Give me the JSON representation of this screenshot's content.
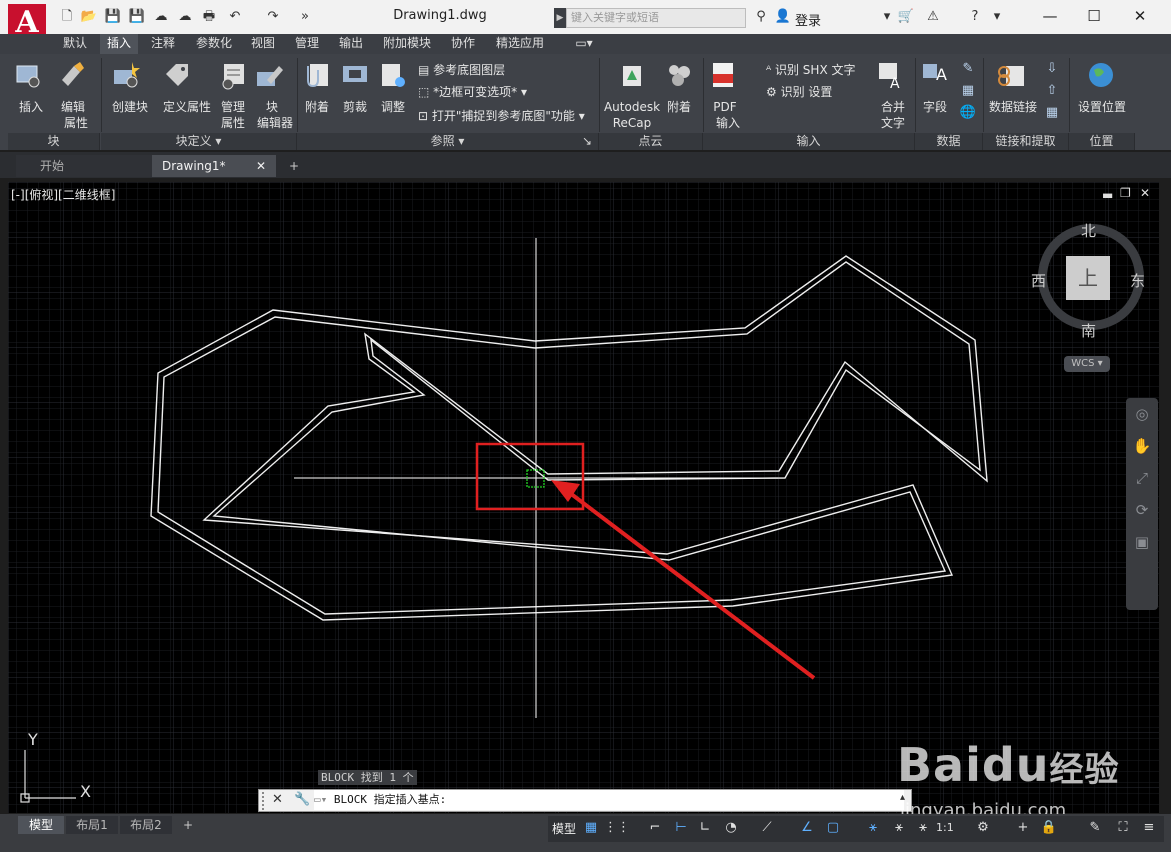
{
  "app": {
    "logo_letter": "A",
    "document_title": "Drawing1.dwg"
  },
  "search": {
    "placeholder": "键入关键字或短语"
  },
  "account": {
    "login_label": "登录"
  },
  "ribbon_tabs": [
    "默认",
    "插入",
    "注释",
    "参数化",
    "视图",
    "管理",
    "输出",
    "附加模块",
    "协作",
    "精选应用"
  ],
  "active_tab": "插入",
  "panels": {
    "block": {
      "title": "块",
      "insert": "插入",
      "edit_attr_1": "编辑",
      "edit_attr_2": "属性"
    },
    "block_def": {
      "title": "块定义",
      "create_block": "创建块",
      "define_attr": "定义属性",
      "manage_attr_1": "管理",
      "manage_attr_2": "属性",
      "block_editor_1": "块",
      "block_editor_2": "编辑器"
    },
    "reference": {
      "title": "参照",
      "attach": "附着",
      "clip": "剪裁",
      "adjust": "调整",
      "underlay_layers": "参考底图图层",
      "frames_variable": "*边框可变选项*",
      "snap_underlay": "打开\"捕捉到参考底图\"功能"
    },
    "point_cloud": {
      "title": "点云",
      "recap_1": "Autodesk",
      "recap_2": "ReCap",
      "attach": "附着"
    },
    "import": {
      "title": "输入",
      "pdf_1": "PDF",
      "pdf_2": "输入",
      "recognize_shx": "识别 SHX 文字",
      "recognize_settings": "识别 设置",
      "combine_1": "合并",
      "combine_2": "文字"
    },
    "data": {
      "title": "数据",
      "field": "字段"
    },
    "linking": {
      "title": "链接和提取",
      "data_link": "数据链接"
    },
    "location": {
      "title": "位置",
      "set_location": "设置位置"
    }
  },
  "file_tabs": {
    "start": "开始",
    "drawing": "Drawing1*",
    "new_tab": "+"
  },
  "viewport": {
    "label": "[-][俯视][二维线框]"
  },
  "viewcube": {
    "north": "北",
    "south": "南",
    "east": "东",
    "west": "西",
    "top": "上",
    "wcs": "WCS"
  },
  "ucs": {
    "x": "X",
    "y": "Y"
  },
  "command": {
    "history": "BLOCK 找到 1 个",
    "prompt": "BLOCK 指定插入基点:"
  },
  "layout_tabs": [
    "模型",
    "布局1",
    "布局2"
  ],
  "status": {
    "model_label": "模型",
    "scale": "1:1"
  },
  "watermark": {
    "logo": "Baidu",
    "sublogo": "经验",
    "url": "jingyan.baidu.com"
  },
  "colors": {
    "accent_red": "#e02020",
    "logo_red": "#c8102e",
    "status_blue": "#5fb0ff"
  }
}
